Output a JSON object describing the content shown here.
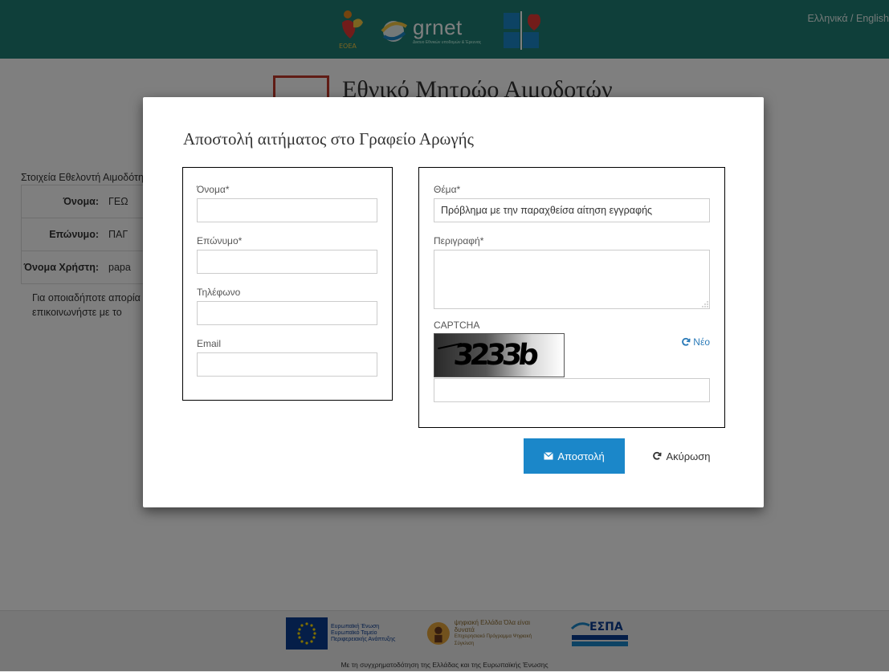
{
  "header": {
    "logo_left": "ΕΟΕΑ",
    "logo_grnet": "grnet",
    "logo_grnet_tagline": "Δικτυο Εθνικών υποδομών & Έρευνας",
    "language_switch": "Ελληνικά / English"
  },
  "page": {
    "title": "Εθνικό Μητρώο Αιμοδοτών",
    "volunteer_caption": "Στοιχεία Εθελοντή Αιμοδότη",
    "volunteer_rows": [
      {
        "label": "Όνομα:",
        "value": "ΓΕΩ"
      },
      {
        "label": "Επώνυμο:",
        "value": "ΠΑΓ"
      },
      {
        "label": "Όνομα Χρήστη:",
        "value": "papa"
      }
    ],
    "contact_note": "Για οποιαδήποτε απορία επικοινωνήστε με το"
  },
  "modal": {
    "title": "Αποστολή αιτήματος στο Γραφείο Αρωγής",
    "first_name_label": "Όνομα*",
    "first_name_value": "",
    "last_name_label": "Επώνυμο*",
    "last_name_value": "",
    "phone_label": "Τηλέφωνο",
    "phone_value": "",
    "email_label": "Email",
    "email_value": "",
    "subject_label": "Θέμα*",
    "subject_value": "Πρόβλημα με την παραχθείσα αίτηση εγγραφής",
    "description_label": "Περιγραφή*",
    "description_value": "",
    "captcha_label": "CAPTCHA",
    "captcha_text": "3233b",
    "captcha_refresh": "Νέο",
    "captcha_input_value": "",
    "send_button": "Αποστολή",
    "cancel_button": "Ακύρωση"
  },
  "footer": {
    "eu_text": "Ευρωπαϊκή Ένωση Ευρωπαϊκό Ταμείο Περιφερειακής Ανάπτυξης",
    "digital_text": "ψηφιακή Ελλάδα Όλα είναι δυνατά",
    "digital_sub": "Επιχειρησιακό Πρόγραμμα Ψηφιακή Σύγκλιση",
    "espa_text": "ΕΣΠΑ",
    "caption": "Με τη συγχρηματοδότηση της Ελλάδας και της Ευρωπαϊκής Ένωσης"
  },
  "colors": {
    "header_bg": "#1e7f74",
    "send_button_bg": "#1b87c9",
    "link": "#2a7ab8"
  }
}
